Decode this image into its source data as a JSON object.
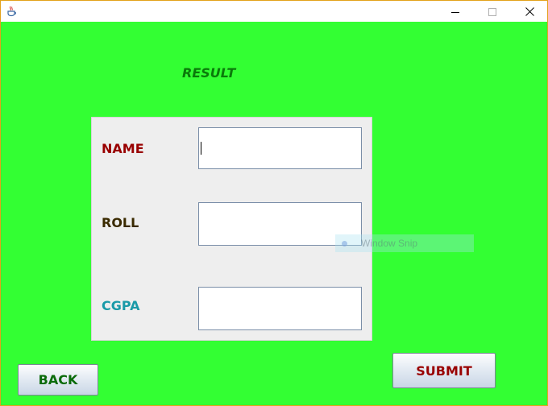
{
  "titlebar": {
    "app_icon": "java-cup-icon",
    "controls": [
      "minimize-icon",
      "maximize-icon",
      "close-icon"
    ]
  },
  "main": {
    "heading": "RESULT",
    "fields": [
      {
        "label": "NAME",
        "value": "",
        "color": "#990000"
      },
      {
        "label": "ROLL",
        "value": "",
        "color": "#3a2a00"
      },
      {
        "label": "CGPA",
        "value": "",
        "color": "#1a9aa8"
      }
    ],
    "back_label": "BACK",
    "submit_label": "SUBMIT"
  },
  "overlay": {
    "snip_label": "Window Snip"
  },
  "colors": {
    "background": "#33ff33",
    "heading": "#0a7a0a",
    "back_text": "#0a6b0a",
    "submit_text": "#990000",
    "frame_border": "#e3a21a"
  }
}
